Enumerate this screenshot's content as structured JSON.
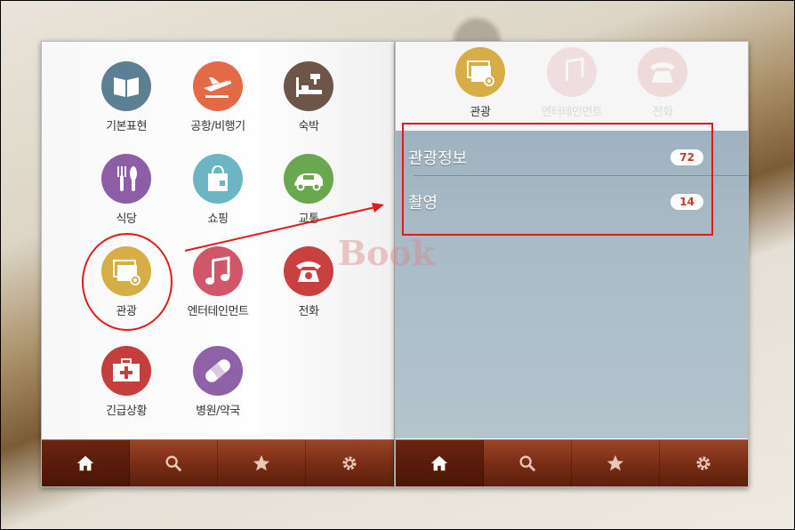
{
  "categories": [
    {
      "label": "기본표현",
      "color": "#5d7f93",
      "icon": "book-icon"
    },
    {
      "label": "공항/비행기",
      "color": "#e26a44",
      "icon": "airplane-icon"
    },
    {
      "label": "숙박",
      "color": "#6f5549",
      "icon": "bed-icon"
    },
    {
      "label": "식당",
      "color": "#8d5ea5",
      "icon": "cutlery-icon"
    },
    {
      "label": "쇼핑",
      "color": "#6bb6c2",
      "icon": "shopping-bag-icon"
    },
    {
      "label": "교통",
      "color": "#6aa84f",
      "icon": "car-icon"
    },
    {
      "label": "관광",
      "color": "#d6ae45",
      "icon": "camera-photo-icon"
    },
    {
      "label": "엔터테인먼트",
      "color": "#d2566a",
      "icon": "music-note-icon"
    },
    {
      "label": "전화",
      "color": "#c94040",
      "icon": "telephone-icon"
    },
    {
      "label": "긴급상황",
      "color": "#c43e3e",
      "icon": "first-aid-kit-icon"
    },
    {
      "label": "병원/약국",
      "color": "#8f62a8",
      "icon": "bandage-icon"
    }
  ],
  "right_panel": {
    "top_items": [
      {
        "label": "관광",
        "color": "#d6ae45",
        "icon": "camera-photo-icon"
      },
      {
        "label": "엔터테인먼트",
        "color": "#d2566a",
        "icon": "music-note-icon"
      },
      {
        "label": "전화",
        "color": "#c94040",
        "icon": "telephone-icon"
      }
    ],
    "list": [
      {
        "label": "관광정보",
        "count": "72"
      },
      {
        "label": "촬영",
        "count": "14"
      }
    ]
  },
  "tabbar": {
    "tabs": [
      {
        "icon": "home-icon"
      },
      {
        "icon": "search-icon"
      },
      {
        "icon": "star-icon"
      },
      {
        "icon": "gear-icon"
      }
    ]
  },
  "watermark": "Book"
}
